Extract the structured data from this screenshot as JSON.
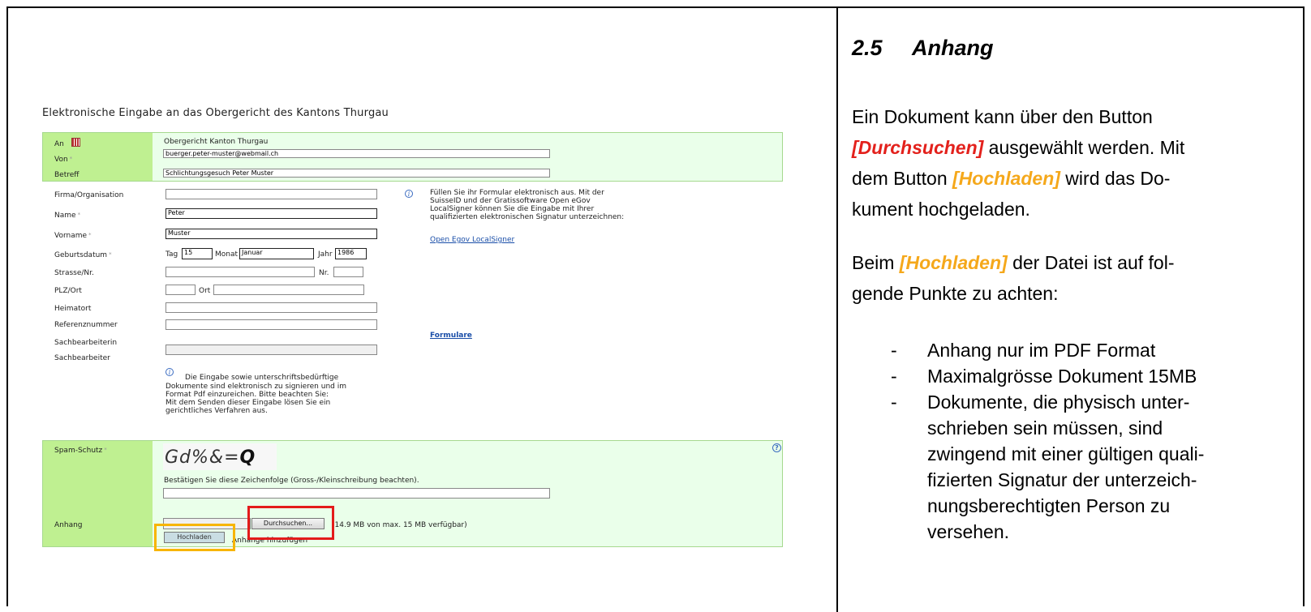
{
  "form": {
    "title": "Elektronische Eingabe an das Obergericht des Kantons Thurgau",
    "header": {
      "an_label": "An",
      "an_value": "Obergericht Kanton Thurgau",
      "von_label": "Von",
      "von_value": "buerger.peter-muster@webmail.ch",
      "betreff_label": "Betreff",
      "betreff_value": "Schlichtungsgesuch Peter Muster"
    },
    "fields": {
      "firma_label": "Firma/Organisation",
      "firma_value": "",
      "name_label": "Name",
      "name_value": "Peter",
      "vorname_label": "Vorname",
      "vorname_value": "Muster",
      "geburtsdatum_label": "Geburtsdatum",
      "tag_label": "Tag",
      "tag_value": "15",
      "monat_label": "Monat",
      "monat_value": "Januar",
      "jahr_label": "Jahr",
      "jahr_value": "1986",
      "strasse_label": "Strasse/Nr.",
      "nr_label": "Nr.",
      "plz_label": "PLZ/Ort",
      "ort_label": "Ort",
      "heimatort_label": "Heimatort",
      "referenz_label": "Referenznummer",
      "sachbearbeiterin_label": "Sachbearbeiterin",
      "sachbearbeiter_label": "Sachbearbeiter"
    },
    "info_text": [
      "Füllen Sie ihr Formular elektronisch aus. Mit der",
      "SuisseID und der Gratissoftware Open eGov",
      "LocalSigner können Sie die Eingabe mit Ihrer",
      "qualifizierten elektronischen Signatur unterzeichnen:"
    ],
    "link_localsigner": "Open Egov LocalSigner",
    "link_formulare": "Formulare",
    "signature_note": [
      "Die Eingabe sowie unterschriftsbedürftige",
      "Dokumente sind elektronisch zu signieren und im",
      "Format Pdf einzureichen. Bitte beachten Sie:",
      "Mit dem Senden dieser Eingabe lösen Sie ein",
      "gerichtliches Verfahren aus."
    ],
    "spam_label": "Spam-Schutz",
    "captcha_text": "Gd%&=",
    "captcha_last": "Q",
    "captcha_hint": "Bestätigen Sie diese Zeichenfolge (Gross-/Kleinschreibung beachten).",
    "anhang_label": "Anhang",
    "browse_button": "Durchsuchen...",
    "quota_text": "(14.9 MB von max. 15 MB verfügbar)",
    "upload_button": "Hochladen",
    "add_attachments": "Anhänge hinzufügen"
  },
  "manual": {
    "section_number": "2.5",
    "section_title": "Anhang",
    "p1_a": "Ein Dokument kann über den Button",
    "p1_b": "[Durchsuchen]",
    "p1_c": " ausgewählt werden. Mit",
    "p1_d": "dem Button ",
    "p1_e": "[Hochladen]",
    "p1_f": " wird das Do-",
    "p1_g": "kument hochgeladen.",
    "p2_a": "Beim ",
    "p2_b": "[Hochladen]",
    "p2_c": " der Datei ist auf fol-",
    "p2_d": "gende Punkte zu achten:",
    "bullets": [
      "Anhang nur im PDF Format",
      "Maximalgrösse Dokument 15MB",
      "Dokumente, die physisch unter-",
      "schrieben sein müssen, sind",
      "zwingend mit einer gültigen quali-",
      "fizierten Signatur der unterzeich-",
      "nungsberechtigten Person zu",
      "versehen."
    ],
    "bullet_dash": "-",
    "colors": {
      "red": "#e3211c",
      "orange": "#f5a81b",
      "green_label": "#bff091",
      "green_panel": "#eaffea"
    }
  }
}
